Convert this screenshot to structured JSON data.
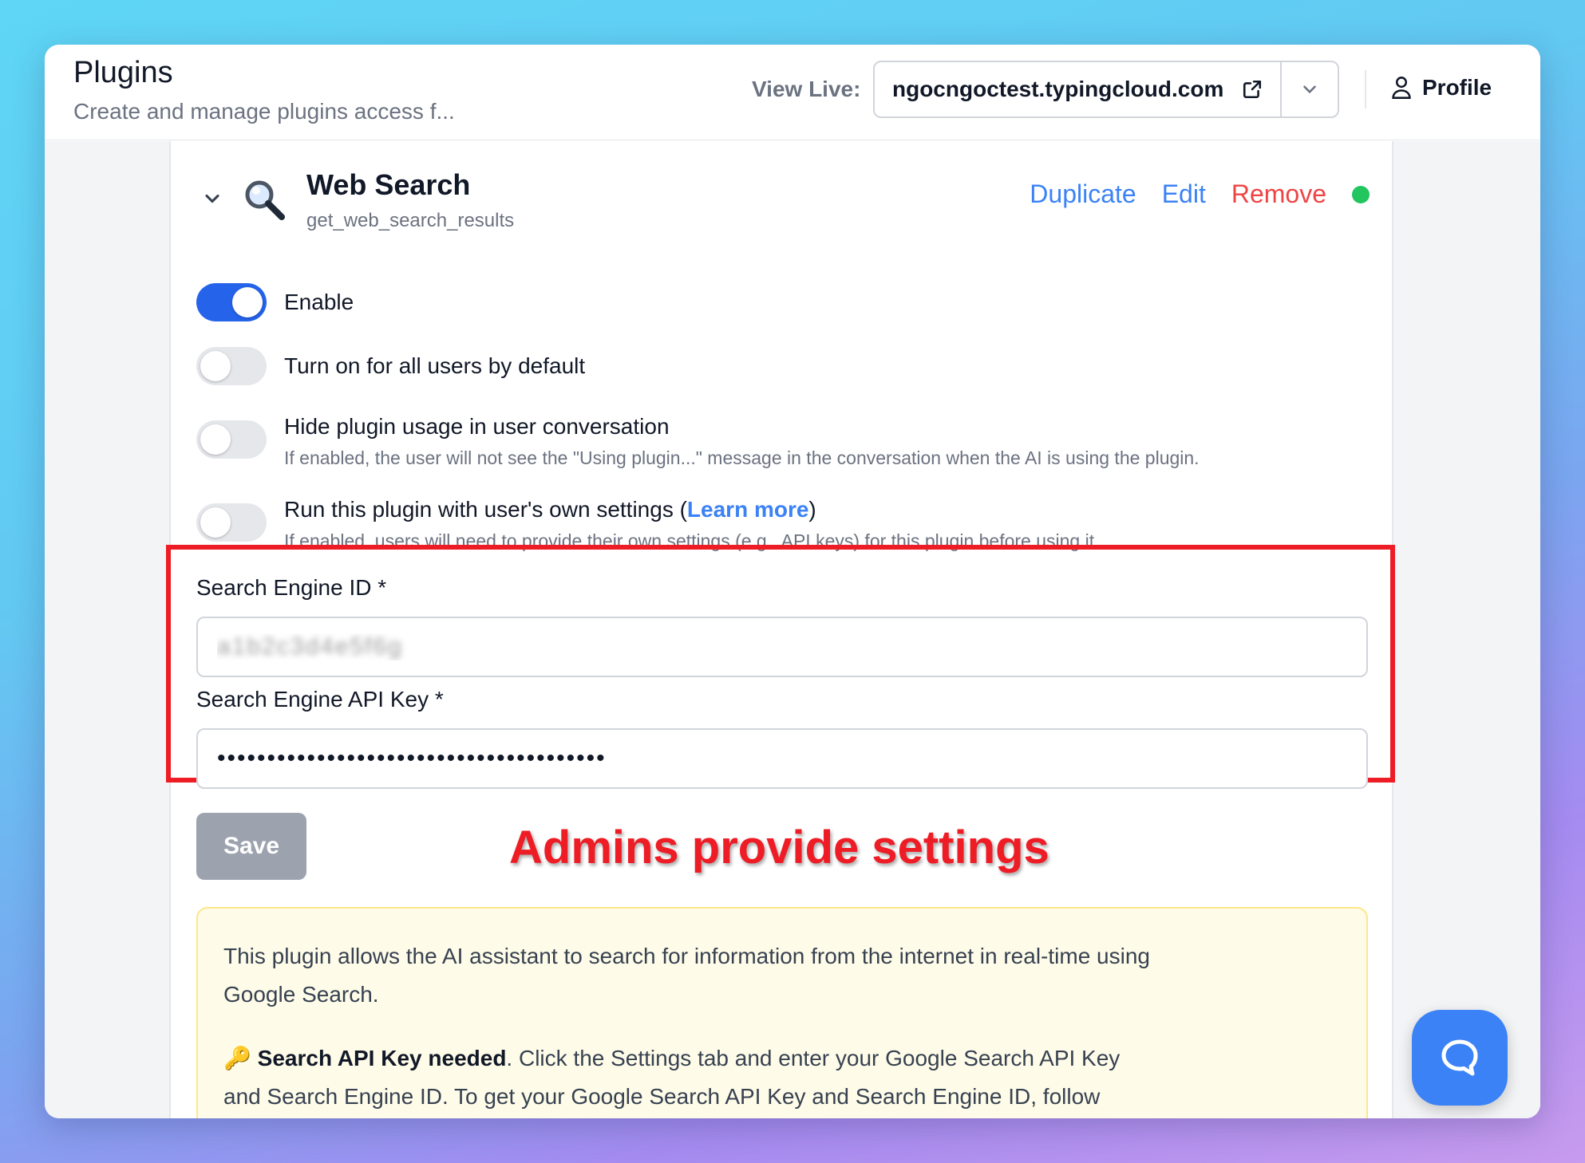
{
  "header": {
    "title": "Plugins",
    "subtitle": "Create and manage plugins access f...",
    "view_live_label": "View Live:",
    "site": "ngocngoctest.typingcloud.com",
    "profile_label": "Profile"
  },
  "plugin": {
    "name": "Web Search",
    "function_name": "get_web_search_results",
    "actions": {
      "duplicate": "Duplicate",
      "edit": "Edit",
      "remove": "Remove"
    },
    "status_color": "#22c55e",
    "options": [
      {
        "label": "Enable",
        "enabled": true
      },
      {
        "label": "Turn on for all users by default",
        "enabled": false
      },
      {
        "label": "Hide plugin usage in user conversation",
        "description": "If enabled, the user will not see the \"Using plugin...\" message in the conversation when the AI is using the plugin.",
        "enabled": false
      },
      {
        "label_prefix": "Run this plugin with user's own settings (",
        "link": "Learn more",
        "label_suffix": ")",
        "description": "If enabled, users will need to provide their own settings (e.g., API keys) for this plugin before using it",
        "enabled": false
      }
    ],
    "fields": {
      "engine_id_label": "Search Engine ID *",
      "engine_id_value": "a1b2c3d4e5f6g",
      "api_key_label": "Search Engine API Key *",
      "api_key_value": "•••••••••••••••••••••••••••••••••••••••"
    },
    "save_label": "Save",
    "annotation": "Admins provide settings",
    "info": {
      "paragraph1": "This plugin allows the AI assistant to search for information from the internet in real-time using Google Search.",
      "key_emoji": "🔑",
      "bold_text": "Search API Key needed",
      "paragraph2": ". Click the Settings tab and enter your Google Search API Key and Search Engine ID. To get your Google Search API Key and Search Engine ID, follow"
    }
  },
  "colors": {
    "accent": "#3b82f6",
    "danger": "#ef4444",
    "highlight_box": "#ee1c25"
  }
}
